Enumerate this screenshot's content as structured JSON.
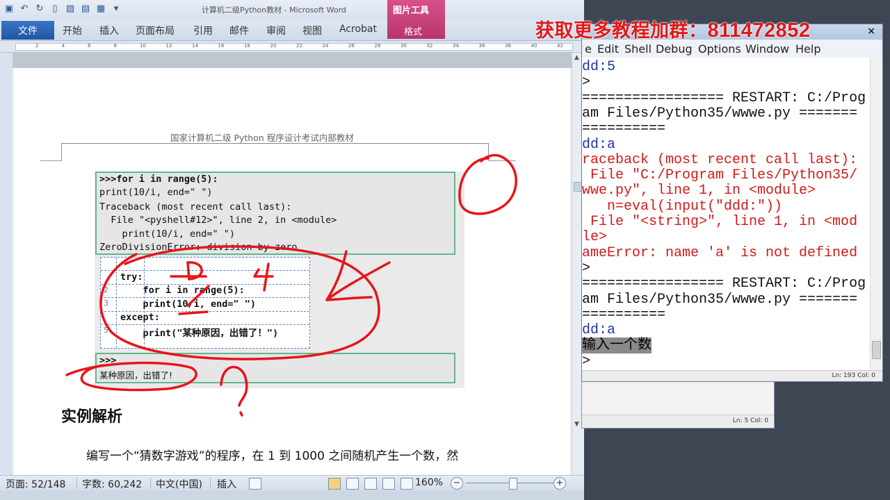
{
  "word": {
    "doc_title": "计算机二级Python教材 - Microsoft Word",
    "picture_tools": "图片工具",
    "picture_tools_format": "格式",
    "file_tab": "文件",
    "tabs": [
      "开始",
      "插入",
      "页面布局",
      "引用",
      "邮件",
      "审阅",
      "视图",
      "Acrobat"
    ],
    "ruler_numbers": [
      "2",
      "4",
      "6",
      "8",
      "10",
      "12",
      "14",
      "16",
      "18",
      "20",
      "22",
      "24",
      "26",
      "28",
      "30",
      "32",
      "34",
      "36",
      "38",
      "40",
      "42"
    ],
    "page_header": "国家计算机二级 Python 程序设计考试内部教材",
    "code_block_1": [
      ">>>for i in range(5):",
      "print(10/i, end=\" \")",
      "Traceback (most recent call last):",
      "  File \"<pyshell#12>\", line 2, in <module>",
      "    print(10/i, end=\" \")",
      "ZeroDivisionError: division by zero"
    ],
    "code_block_2": [
      {
        "num": "",
        "text": "try:"
      },
      {
        "num": "2",
        "text": "    for i in range(5):"
      },
      {
        "num": "3",
        "text": "    print(10/i, end=\" \")"
      },
      {
        "num": "",
        "text": "except:"
      },
      {
        "num": "5",
        "text": "    print(\"某种原因，出错了！\")"
      }
    ],
    "code_block_3": [
      ">>>",
      "某种原因，出错了!"
    ],
    "section_heading": "实例解析",
    "paragraph": "编写一个“猜数字游戏”的程序，在 1 到 1000  之间随机产生一个数，然",
    "status": {
      "page": "页面: 52/148",
      "words": "字数: 60,242",
      "language": "中文(中国)",
      "insert": "插入",
      "zoom": "160%",
      "zoom_minus": "−",
      "zoom_plus": "+",
      "zoom_level_percent": 160
    }
  },
  "idle": {
    "menu": [
      "e",
      "Edit",
      "Shell",
      "Debug",
      "Options",
      "Window",
      "Help"
    ],
    "close": "×",
    "lines": [
      {
        "text": "dd:5",
        "color": "blue"
      },
      {
        "text": ">",
        "color": "black"
      },
      {
        "text": "================= RESTART: C:/Prog",
        "color": "black"
      },
      {
        "text": "am Files/Python35/wwwe.py =======",
        "color": "black"
      },
      {
        "text": "==========",
        "color": "black"
      },
      {
        "text": "dd:a",
        "color": "blue"
      },
      {
        "text": "raceback (most recent call last):",
        "color": "red"
      },
      {
        "text": " File \"C:/Program Files/Python35/",
        "color": "red"
      },
      {
        "text": "wwe.py\", line 1, in <module>",
        "color": "red"
      },
      {
        "text": "   n=eval(input(\"ddd:\"))",
        "color": "red"
      },
      {
        "text": " File \"<string>\", line 1, in <mod",
        "color": "red"
      },
      {
        "text": "le>",
        "color": "red"
      },
      {
        "text": "ameError: name 'a' is not defined",
        "color": "red"
      },
      {
        "text": ">",
        "color": "black"
      },
      {
        "text": "================= RESTART: C:/Prog",
        "color": "black"
      },
      {
        "text": "am Files/Python35/wwwe.py =======",
        "color": "black"
      },
      {
        "text": "==========",
        "color": "black"
      },
      {
        "text": "dd:a",
        "color": "blue"
      },
      {
        "text": "输入一个数",
        "color": "black",
        "selected": true
      },
      {
        "text": ">",
        "color": "black"
      }
    ],
    "status": "Ln: 193  Col: 0",
    "back_status": "Ln: 5  Col: 0"
  },
  "banner": {
    "text": "获取更多教程加群：",
    "number": "811472852"
  },
  "annotations": {
    "label_d": "D",
    "label_4": "4",
    "label_q": "?"
  },
  "colors": {
    "word_blue": "#1f56a3",
    "picture_tools_pink": "#c4407a",
    "code_border_green": "#5fb88a",
    "idle_blue": "#1e36a6",
    "idle_red": "#d01a1a",
    "annotation_red": "#e8141a"
  }
}
